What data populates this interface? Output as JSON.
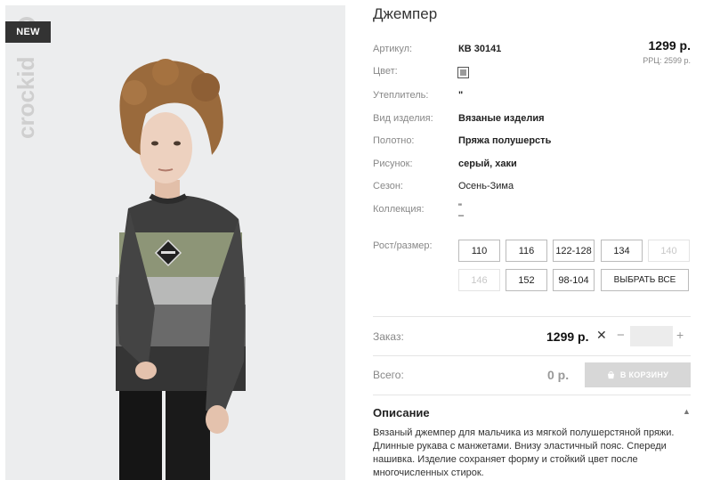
{
  "badge": "NEW",
  "brand": "crockid",
  "product": {
    "title": "Джемпер",
    "price": "1299 р.",
    "rrp": "РРЦ: 2599 р."
  },
  "attributes": [
    {
      "label": "Артикул:",
      "value": "КВ 30141"
    },
    {
      "label": "Цвет:",
      "value": ""
    },
    {
      "label": "Утеплитель:",
      "value": "\""
    },
    {
      "label": "Вид изделия:",
      "value": "Вязаные изделия"
    },
    {
      "label": "Полотно:",
      "value": "Пряжа полушерсть"
    },
    {
      "label": "Рисунок:",
      "value": "серый, хаки"
    },
    {
      "label": "Сезон:",
      "value": "Осень-Зима"
    },
    {
      "label": "Коллекция:",
      "value": "\"\n–"
    }
  ],
  "color_swatch": "#9a9a9a",
  "sizes": {
    "label": "Рост/размер:",
    "options": [
      {
        "text": "110",
        "available": true
      },
      {
        "text": "116",
        "available": true
      },
      {
        "text": "122-128",
        "available": true
      },
      {
        "text": "134",
        "available": true
      },
      {
        "text": "140",
        "available": false
      },
      {
        "text": "146",
        "available": false
      },
      {
        "text": "152",
        "available": true
      },
      {
        "text": "98-104",
        "available": true
      },
      {
        "text": "ВЫБРАТЬ ВСЕ",
        "available": true
      }
    ]
  },
  "order": {
    "label": "Заказ:",
    "price": "1299 р.",
    "quantity": ""
  },
  "total": {
    "label": "Всего:",
    "value": "0 р.",
    "cart_button": "В КОРЗИНУ"
  },
  "description": {
    "heading": "Описание",
    "text": "Вязаный джемпер для мальчика из мягкой полушерстяной пряжи. Длинные рукава с манжетами. Внизу эластичный пояс. Спереди нашивка. Изделие сохраняет форму и стойкий цвет после многочисленных стирок."
  }
}
